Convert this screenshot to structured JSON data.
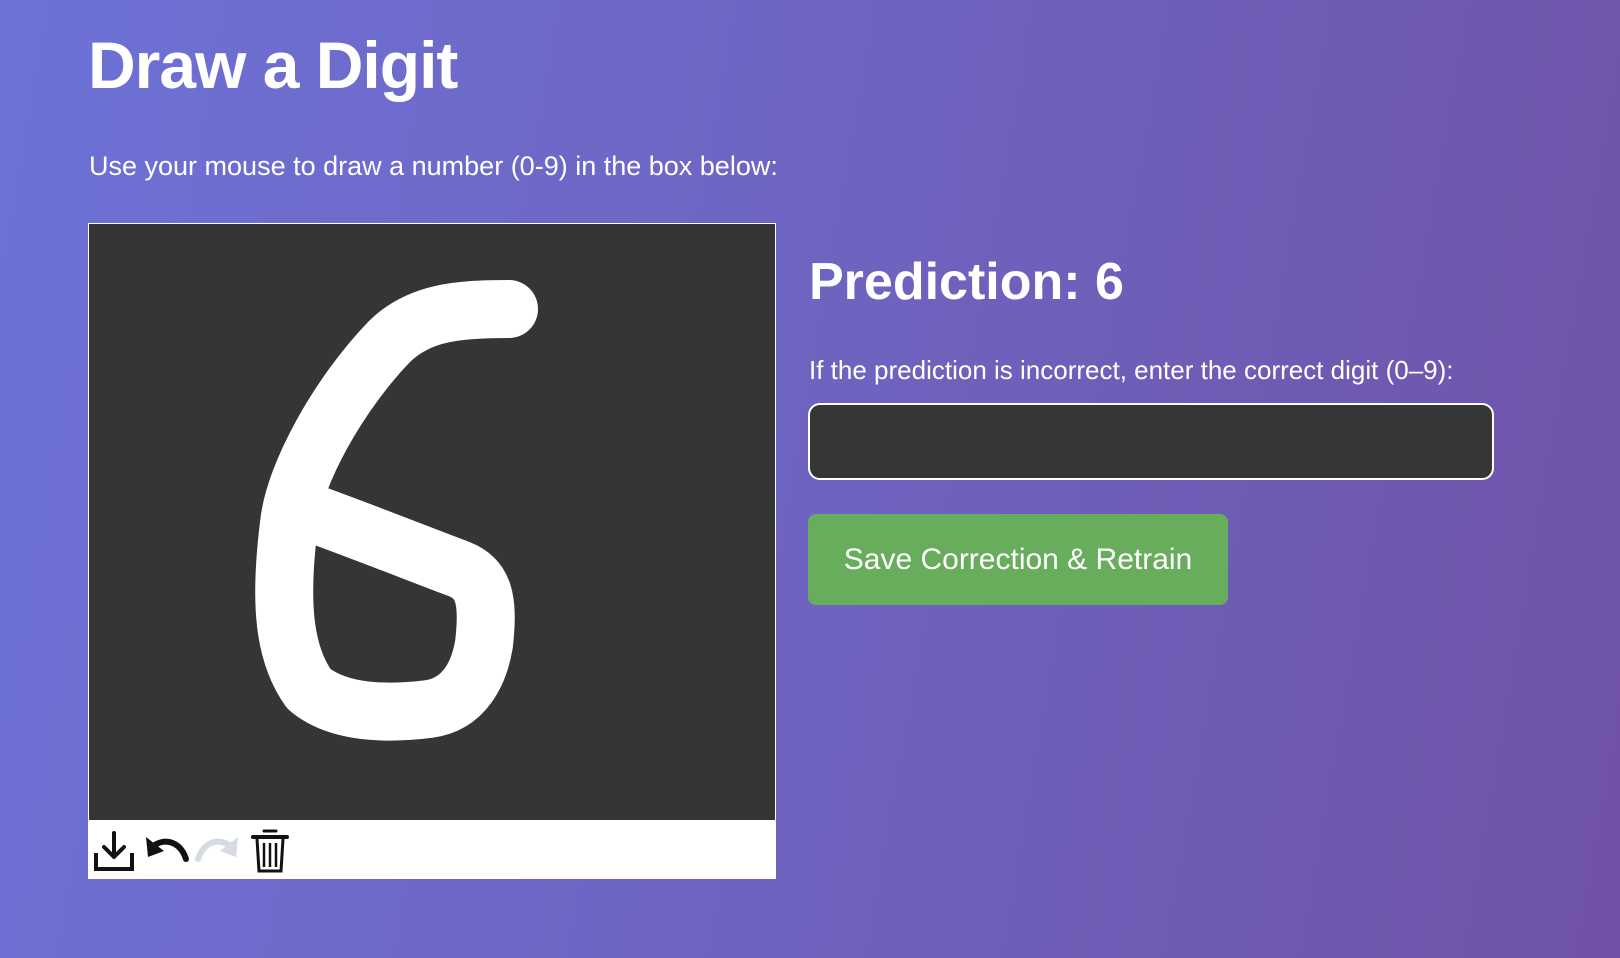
{
  "page": {
    "title": "Draw a Digit",
    "instruction": "Use your mouse to draw a number (0-9) in the box below:"
  },
  "canvas": {
    "drawn_digit": "6",
    "toolbar": [
      {
        "icon": "download-icon",
        "enabled": true
      },
      {
        "icon": "undo-icon",
        "enabled": true
      },
      {
        "icon": "redo-icon",
        "enabled": false
      },
      {
        "icon": "trash-icon",
        "enabled": true
      }
    ]
  },
  "result": {
    "prediction_text": "Prediction: 6",
    "correction_label": "If the prediction is incorrect, enter the correct digit (0–9):",
    "correction_value": "",
    "save_label": "Save Correction & Retrain"
  },
  "colors": {
    "canvas_bg": "#353535",
    "stroke": "#ffffff",
    "button_bg": "#68ad5c",
    "input_bg": "#363636"
  }
}
